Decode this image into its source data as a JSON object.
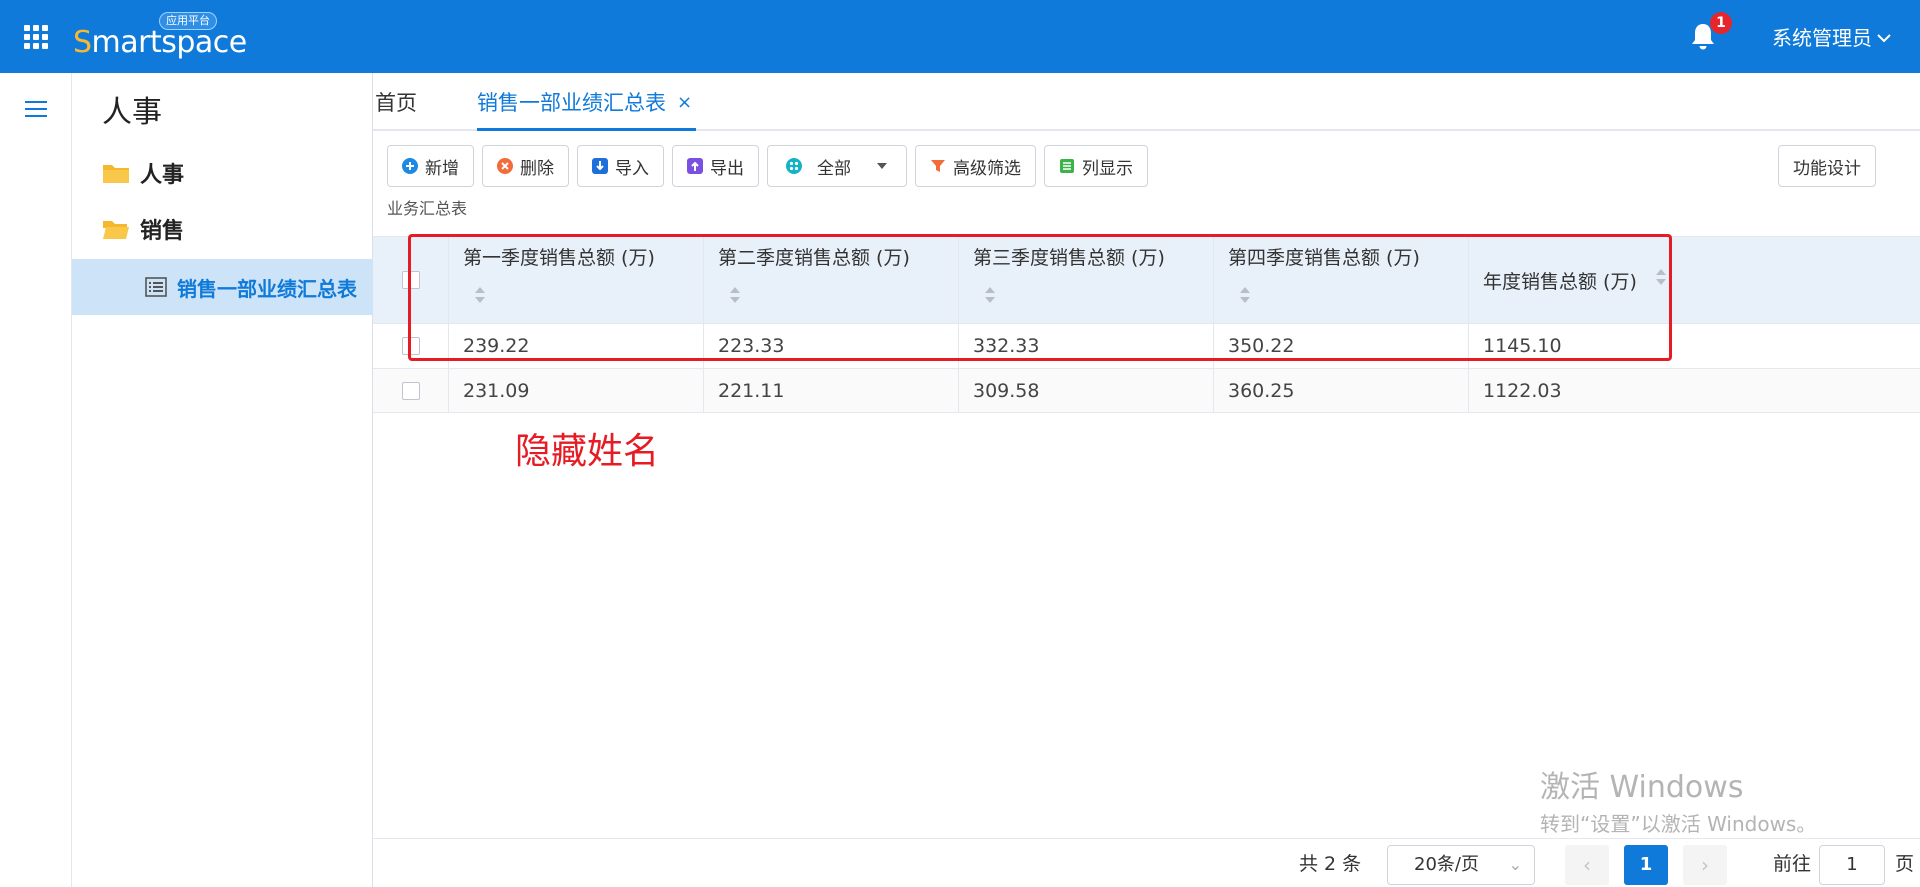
{
  "app": {
    "logo_text_first": "S",
    "logo_text_rest": "martspace",
    "logo_tag": "应用平台"
  },
  "header": {
    "notification_count": "1",
    "user_name": "系统管理员"
  },
  "sidebar": {
    "title": "人事",
    "items": [
      {
        "label": "人事"
      },
      {
        "label": "销售"
      }
    ],
    "sub_item": {
      "label": "销售一部业绩汇总表"
    }
  },
  "tabs": {
    "home": "首页",
    "active": "销售一部业绩汇总表",
    "close": "×"
  },
  "toolbar": {
    "add": "新增",
    "delete": "删除",
    "import": "导入",
    "export": "导出",
    "scope": "全部",
    "filter": "高级筛选",
    "columns": "列显示",
    "design": "功能设计"
  },
  "table": {
    "caption": "业务汇总表",
    "columns": [
      "第一季度销售总额 (万)",
      "第二季度销售总额 (万)",
      "第三季度销售总额 (万)",
      "第四季度销售总额 (万)",
      "年度销售总额 (万)"
    ],
    "rows": [
      [
        "239.22",
        "223.33",
        "332.33",
        "350.22",
        "1145.10"
      ],
      [
        "231.09",
        "221.11",
        "309.58",
        "360.25",
        "1122.03"
      ]
    ]
  },
  "annotation": "隐藏姓名",
  "watermark": {
    "line1": "激活 Windows",
    "line2": "转到“设置”以激活 Windows。"
  },
  "pagination": {
    "total": "共 2 条",
    "page_size": "20条/页",
    "prev": "‹",
    "current": "1",
    "next": "›",
    "goto_label": "前往",
    "goto_value": "1",
    "page_suffix": "页"
  },
  "colors": {
    "brand": "#0f7ad9",
    "annotation": "#e51c23",
    "badge": "#e5262c"
  }
}
